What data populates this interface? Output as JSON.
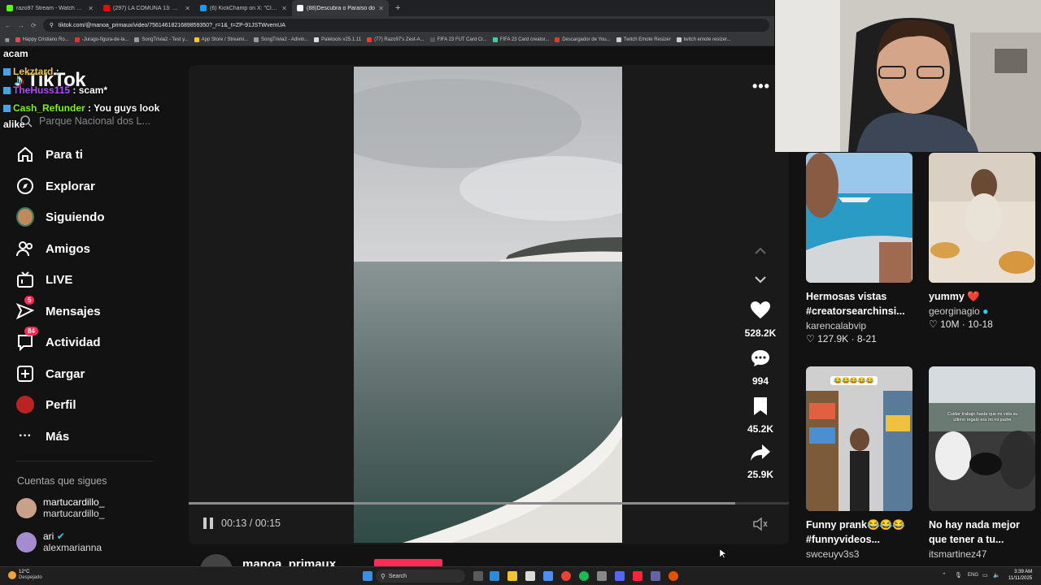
{
  "browser": {
    "tabs": [
      {
        "title": "razo97 Stream - Watch Live on",
        "color": "#53fc18",
        "active": false
      },
      {
        "title": "(297) LA COMUNA 13: Un Barrio",
        "color": "#ff0000",
        "active": false
      },
      {
        "title": "(6) KickChamp on X: \"Clavicu",
        "color": "#1d9bf0",
        "active": false
      },
      {
        "title": "(88)Descubra o Paraíso do",
        "color": "#ffffff",
        "active": true
      }
    ],
    "url": "tiktok.com/@manoa_primaux/video/7561461821689859350?_r=1&_t=ZP-91JSTWvemUA",
    "bookmarks": [
      {
        "label": "Happy Cristiano Ro...",
        "color": "#e45"
      },
      {
        "label": "-Jurago-figura-de-la...",
        "color": "#d33"
      },
      {
        "label": "SongTrivia2 - Test y...",
        "color": "#999"
      },
      {
        "label": "App Store / Streami...",
        "color": "#fc0"
      },
      {
        "label": "SongTrivia2 - Adivin...",
        "color": "#999"
      },
      {
        "label": "Paletools v25.1.11",
        "color": "#ddd"
      },
      {
        "label": "(77) Razo97's Zest-A...",
        "color": "#f33"
      },
      {
        "label": "FIFA 23 FUT Card Cr...",
        "color": "#555"
      },
      {
        "label": "FIFA 23 Card creator...",
        "color": "#4c9"
      },
      {
        "label": "Descargador de You...",
        "color": "#e33"
      },
      {
        "label": "Twitch Emote Resizer",
        "color": "#ccc"
      },
      {
        "label": "twitch emote resizer...",
        "color": "#ccc"
      }
    ]
  },
  "sidebar": {
    "logo": "TikTok",
    "search_placeholder": "Parque Nacional dos L...",
    "items": [
      {
        "label": "Para ti",
        "icon": "home-icon"
      },
      {
        "label": "Explorar",
        "icon": "compass-icon"
      },
      {
        "label": "Siguiendo",
        "icon": "following-avatar-icon"
      },
      {
        "label": "Amigos",
        "icon": "friends-icon"
      },
      {
        "label": "LIVE",
        "icon": "live-tv-icon"
      },
      {
        "label": "Mensajes",
        "icon": "messages-icon",
        "badge": "5"
      },
      {
        "label": "Actividad",
        "icon": "activity-icon",
        "badge": "84"
      },
      {
        "label": "Cargar",
        "icon": "upload-icon"
      },
      {
        "label": "Perfil",
        "icon": "profile-avatar-icon"
      },
      {
        "label": "Más",
        "icon": "more-icon"
      }
    ],
    "following_title": "Cuentas que sigues",
    "following": [
      {
        "name": "martucardillo_",
        "handle": "martucardillo_",
        "verified": false
      },
      {
        "name": "ari",
        "handle": "alexmarianna",
        "verified": true
      }
    ]
  },
  "chat": [
    {
      "user": "",
      "text": "acam",
      "color": "#ffffff"
    },
    {
      "user": "Lekztard",
      "text": ":",
      "color": "#f5c542"
    },
    {
      "user": "TheHuss115",
      "text": ": scam*",
      "color": "#b44dff"
    },
    {
      "user": "Cash_Refunder",
      "text": ": You guys look",
      "color": "#7cfc00"
    },
    {
      "user": "",
      "text": "alike",
      "color": "#ffffff"
    }
  ],
  "player": {
    "time_current": "00:13",
    "time_total": "00:15",
    "progress": 0.91,
    "author": "manoa_primaux",
    "likes": "528.2K",
    "comments": "994",
    "saves": "45.2K",
    "shares": "25.9K"
  },
  "recommended": [
    {
      "title": "Hermosas vistas #creatorsearchinsi...",
      "author": "karencalabvip",
      "likes": "127.9K",
      "date": "8-21",
      "verified": false
    },
    {
      "title": "yummy ❤️",
      "author": "georginagio",
      "likes": "10M",
      "date": "10-18",
      "verified": true
    },
    {
      "title": "Funny prank😂😂😂 #funnyvideos...",
      "author": "swceuyv3s3",
      "likes": "",
      "date": "",
      "verified": false
    },
    {
      "title": "No hay nada mejor que tener a tu...",
      "author": "itsmartinez47",
      "likes": "",
      "date": "",
      "verified": false
    }
  ],
  "thumb_overlays": {
    "prank_caption": "😂😂😂😂😂",
    "car_caption": "Cuidar trabajo hasta que mi vida su ultimo regalo era mi mi padre"
  },
  "taskbar": {
    "weather_temp": "12°C",
    "weather_desc": "Despejado",
    "search_label": "Search",
    "lang": "ENG",
    "time": "3:39 AM",
    "date": "11/11/2025"
  }
}
